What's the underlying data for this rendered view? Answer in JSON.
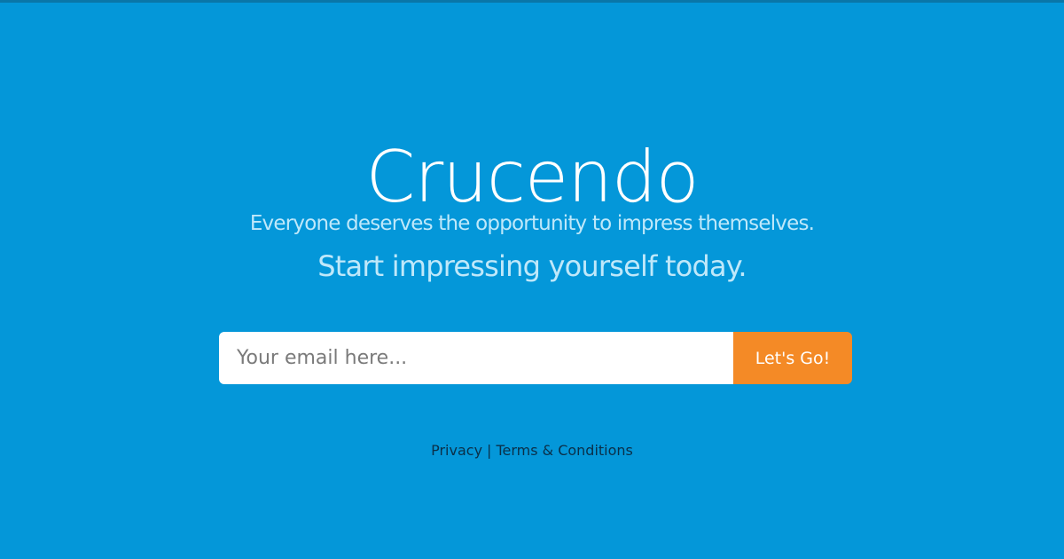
{
  "brand": {
    "name": "Crucendo",
    "tagline": "Everyone deserves the opportunity to impress themselves.",
    "cta": "Start impressing yourself today."
  },
  "signup": {
    "email_placeholder": "Your email here...",
    "email_value": "",
    "submit_label": "Let's Go!"
  },
  "footer": {
    "privacy_label": "Privacy",
    "separator": "|",
    "terms_label": "Terms & Conditions"
  },
  "colors": {
    "background": "#0497d9",
    "button": "#f48a26",
    "text": "#ffffff",
    "subtext": "#bfe8fa",
    "footer_text": "#0b2f48"
  }
}
